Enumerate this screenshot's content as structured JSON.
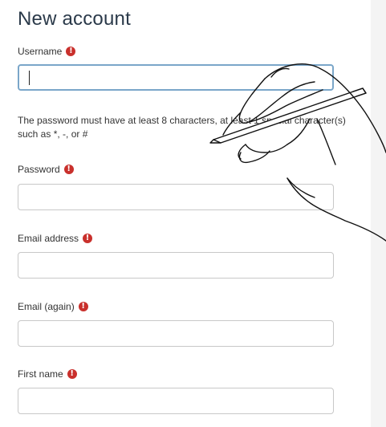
{
  "form": {
    "title": "New account",
    "required_icon_glyph": "!",
    "required_icon_color": "#c9302c",
    "username": {
      "label": "Username",
      "value": ""
    },
    "password_hint": "The password must have at least 8 characters, at least 1 special character(s) such as *, -, or #",
    "password": {
      "label": "Password",
      "value": ""
    },
    "email": {
      "label": "Email address",
      "value": ""
    },
    "email_again": {
      "label": "Email (again)",
      "value": ""
    },
    "first_name": {
      "label": "First name",
      "value": ""
    }
  },
  "overlay": {
    "icon": "hand-holding-pen-icon"
  }
}
